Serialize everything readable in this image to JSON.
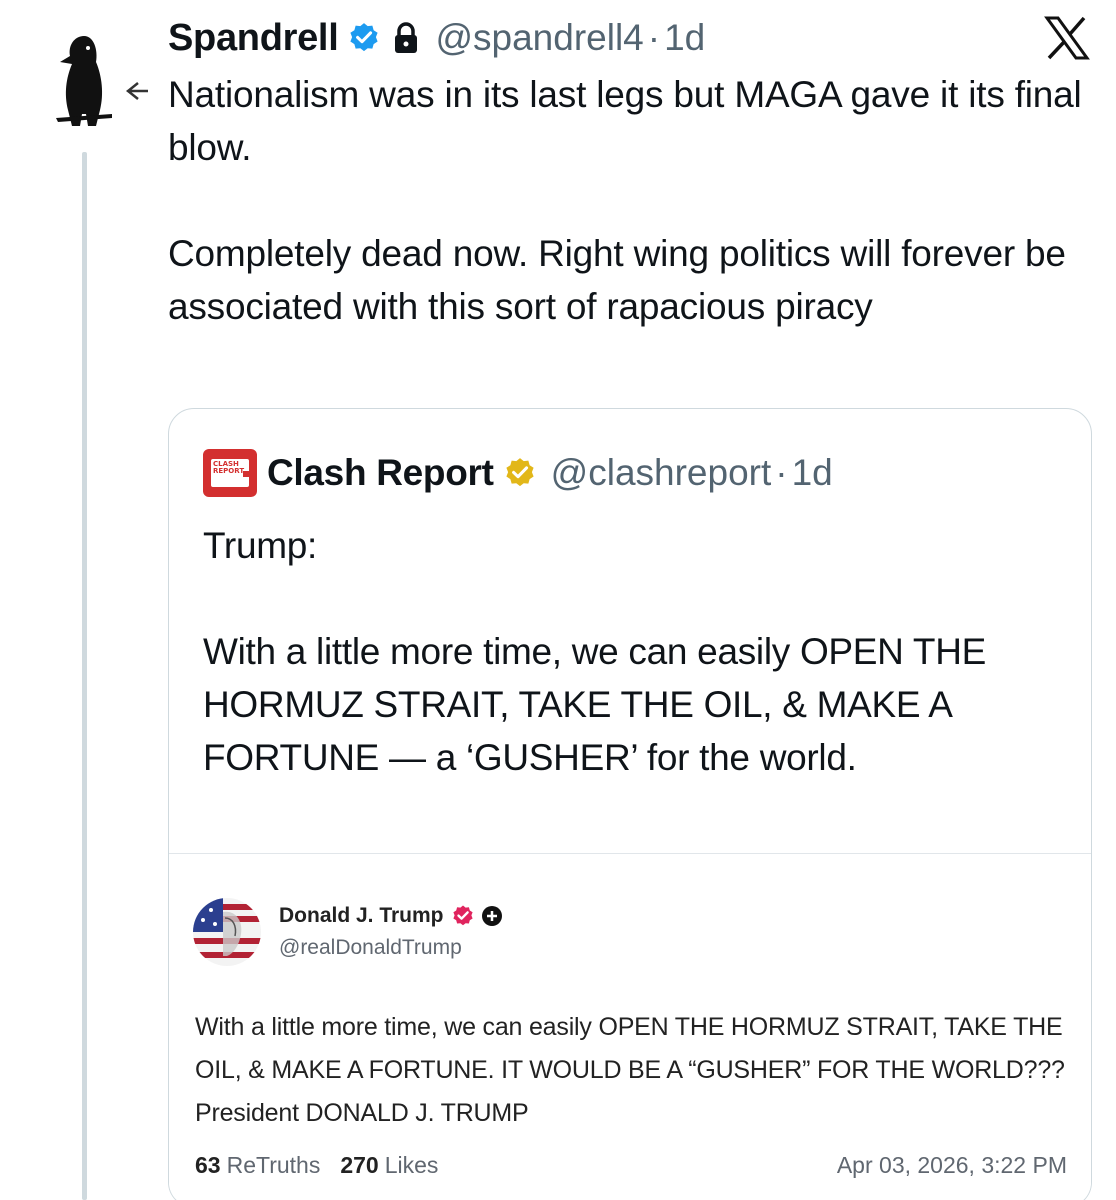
{
  "tweet": {
    "author_name": "Spandrell",
    "handle": "@spandrell4",
    "separator": "·",
    "time": "1d",
    "paragraphs": [
      "Nationalism was in its last legs but MAGA gave it its final blow.",
      "Completely dead now. Right wing politics will forever be associated with this sort of rapacious piracy"
    ]
  },
  "quote": {
    "author_name": "Clash Report",
    "handle": "@clashreport",
    "separator": "·",
    "time": "1d",
    "logo_text": "CLASH REPORT",
    "paragraphs": [
      "Trump:",
      "With a little more time, we can easily OPEN THE HORMUZ STRAIT, TAKE THE OIL, & MAKE A FORTUNE — a ‘GUSHER’ for the world."
    ]
  },
  "embedded_post": {
    "author_name": "Donald J. Trump",
    "handle": "@realDonaldTrump",
    "text": "With a little more time, we can easily OPEN THE HORMUZ STRAIT, TAKE THE OIL, & MAKE A FORTUNE. IT WOULD BE A “GUSHER” FOR THE WORLD??? President DONALD J. TRUMP",
    "retruths_count": "63",
    "retruths_label": "ReTruths",
    "likes_count": "270",
    "likes_label": "Likes",
    "timestamp": "Apr 03, 2026, 3:22 PM"
  },
  "colors": {
    "verified_blue": "#1d9bf0",
    "gold_badge": "#e2b719",
    "secondary_text": "#536471",
    "border": "#cfd9de",
    "clash_red": "#d32f2f",
    "truth_badge": "#e0245e"
  },
  "icons": {
    "avatar": "raven-avatar",
    "verified": "verified-badge-icon",
    "lock": "lock-icon",
    "platform": "x-logo-icon",
    "reply": "reply-arrow-icon"
  }
}
